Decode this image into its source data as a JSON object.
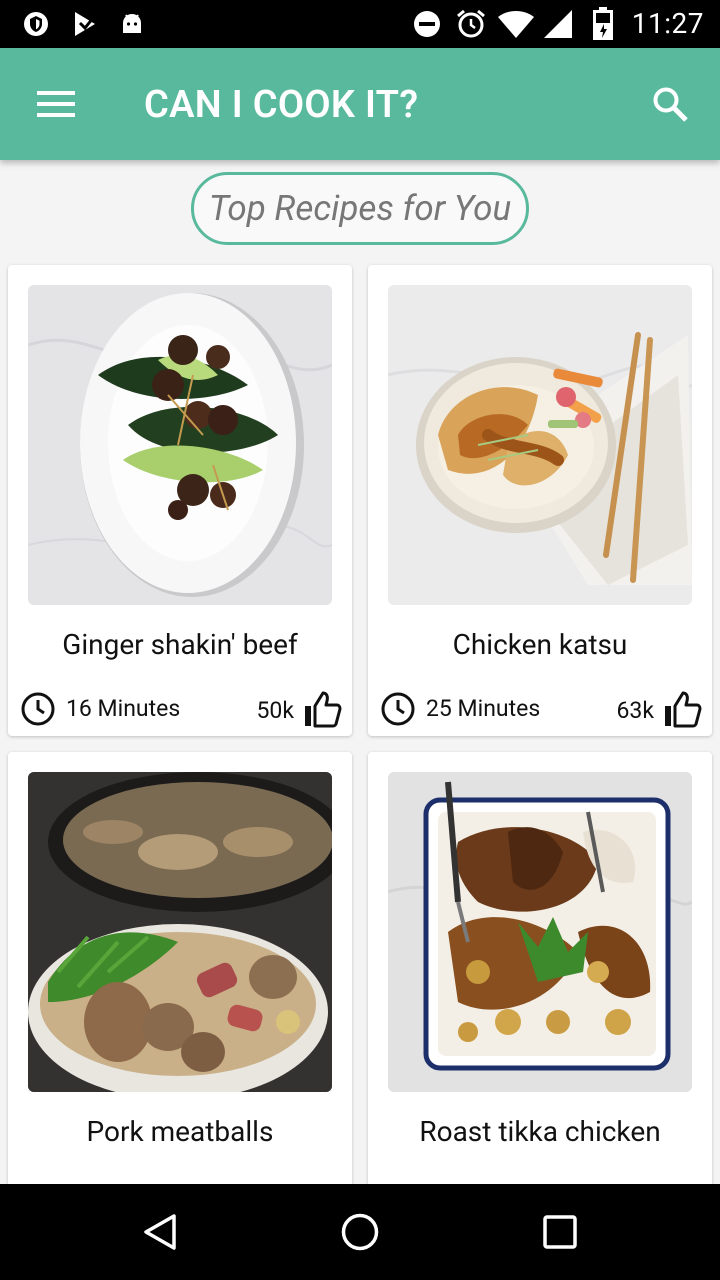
{
  "status_bar": {
    "time": "11:27",
    "icons": [
      "shield-icon",
      "play-store-icon",
      "android-icon",
      "do-not-disturb-icon",
      "alarm-icon",
      "wifi-icon",
      "cellular-signal-icon",
      "battery-icon"
    ]
  },
  "app_bar": {
    "title": "CAN I COOK IT?",
    "menu_icon": "menu-icon",
    "search_icon": "search-icon",
    "color": "#59b99c"
  },
  "section": {
    "label": "Top Recipes for You"
  },
  "recipes": [
    {
      "title": "Ginger shakin' beef",
      "time": "16 Minutes",
      "likes": "50k"
    },
    {
      "title": "Chicken katsu",
      "time": "25 Minutes",
      "likes": "63k"
    },
    {
      "title": "Pork meatballs",
      "time": "",
      "likes": ""
    },
    {
      "title": "Roast tikka chicken",
      "time": "",
      "likes": ""
    }
  ],
  "nav_bar": {
    "icons": [
      "back-icon",
      "home-icon",
      "recents-icon"
    ]
  }
}
